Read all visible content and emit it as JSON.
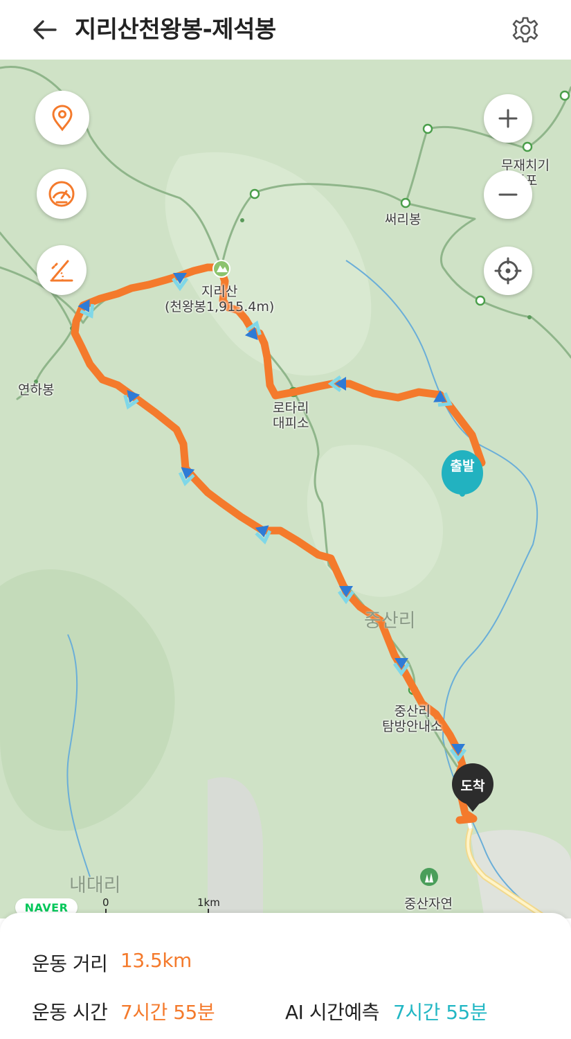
{
  "header": {
    "title": "지리산천왕봉-제석봉"
  },
  "icons": {
    "back": "arrow-left-icon",
    "settings": "gear-icon",
    "location": "map-pin-icon",
    "speed": "speedometer-icon",
    "elevation": "elevation-slope-icon",
    "zoom_in": "plus-icon",
    "zoom_out": "minus-icon",
    "recenter": "crosshair-icon"
  },
  "map": {
    "labels": {
      "peak": "지리산\n(천왕봉1,915.4m)",
      "yeonha": "연하봉",
      "rotary": "로타리\n대피소",
      "sseori": "써리봉",
      "mujae": "무재치기\n폭포",
      "jungsanri": "중산리",
      "info_center": "중산리\n탐방안내소",
      "forest": "중산자연",
      "naedae": "내대리"
    },
    "start_marker": "출발",
    "end_marker": "도착",
    "brand": "NAVER",
    "scale": {
      "zero": "0",
      "distance": "1km"
    }
  },
  "stats": {
    "distance_label": "운동 거리",
    "distance_value": "13.5km",
    "time_label": "운동 시간",
    "time_value": "7시간 55분",
    "ai_label": "AI 시간예측",
    "ai_value": "7시간 55분"
  },
  "colors": {
    "accent_orange": "#f47a2c",
    "ai_teal": "#22b7c4",
    "route": "#f47a2c",
    "start_marker": "#22b2c0",
    "end_marker": "#2c2c2c",
    "map_bg": "#cfe2c6",
    "trail": "#8fb58a",
    "river": "#6aaed8"
  }
}
